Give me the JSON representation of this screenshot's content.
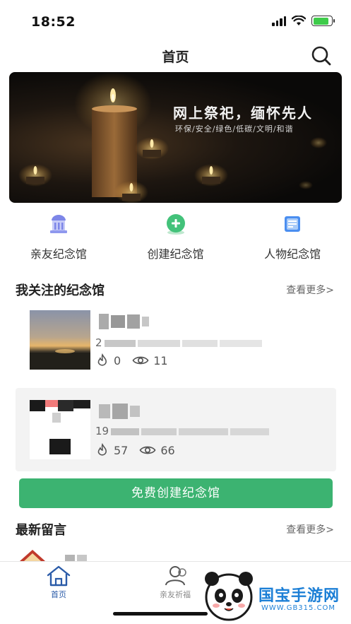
{
  "status_bar": {
    "time": "18:52"
  },
  "nav": {
    "title": "首页"
  },
  "banner": {
    "title": "网上祭祀，缅怀先人",
    "subtitle": "环保/安全/绿色/低碳/文明/和谐"
  },
  "quick_actions": [
    {
      "label": "亲友纪念馆",
      "icon": "memorial-hall-icon"
    },
    {
      "label": "创建纪念馆",
      "icon": "add-circle-icon"
    },
    {
      "label": "人物纪念馆",
      "icon": "document-list-icon"
    }
  ],
  "followed_section": {
    "title": "我关注的纪念馆",
    "more": "查看更多>"
  },
  "memorials": [
    {
      "name_visible": "",
      "date_prefix": "2",
      "flames": "0",
      "views": "11"
    },
    {
      "name_visible": "",
      "date_prefix": "19",
      "flames": "57",
      "views": "66"
    }
  ],
  "create_button": {
    "label": "免费创建纪念馆"
  },
  "messages_section": {
    "title": "最新留言",
    "more": "查看更多>"
  },
  "tab_bar": {
    "tabs": [
      {
        "label": "首页",
        "icon": "home-icon",
        "active": true
      },
      {
        "label": "亲友祈福",
        "icon": "people-icon",
        "active": false
      }
    ]
  },
  "watermark": {
    "text": "国宝手游网",
    "url": "WWW.GB315.COM"
  },
  "colors": {
    "accent_green": "#3cb371",
    "tab_active": "#2a5ba8",
    "watermark_blue": "#1c7fd6"
  }
}
